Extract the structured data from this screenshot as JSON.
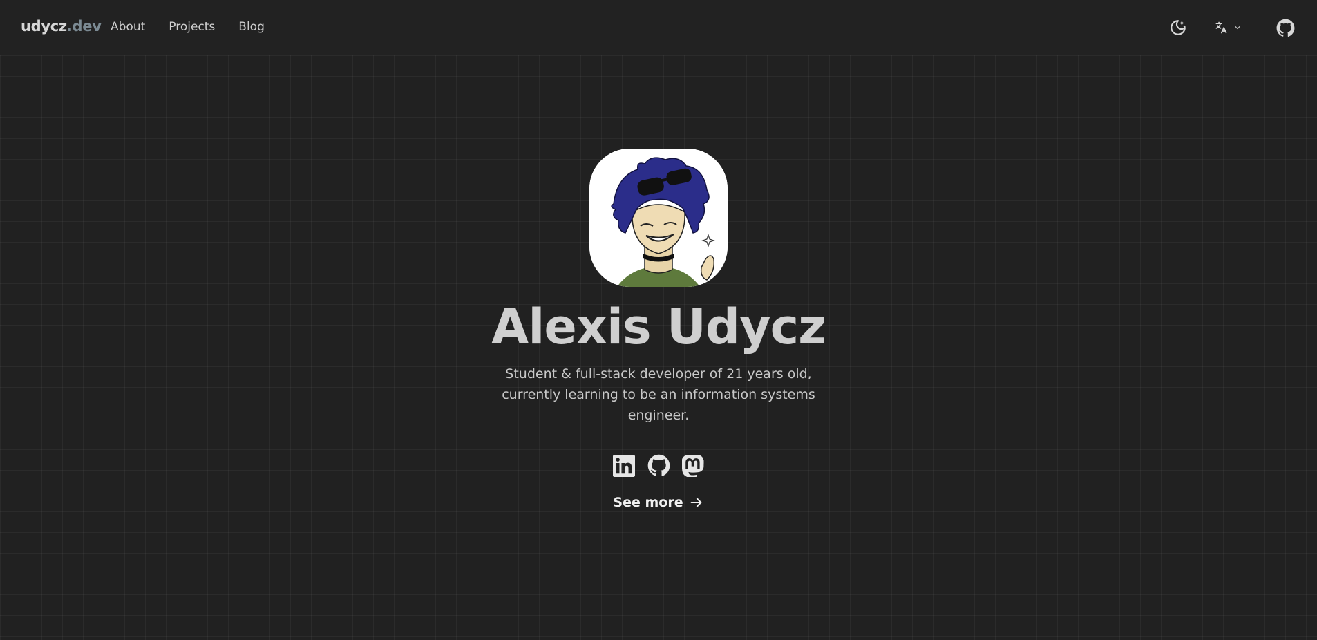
{
  "header": {
    "logo_main": "udycz",
    "logo_suffix": ".dev",
    "nav": [
      {
        "label": "About"
      },
      {
        "label": "Projects"
      },
      {
        "label": "Blog"
      }
    ],
    "icons": [
      "theme-toggle-icon",
      "translate-icon",
      "chevron-down-icon",
      "github-icon"
    ]
  },
  "hero": {
    "name": "Alexis Udycz",
    "tagline": "Student & full-stack developer of 21 years old, currently learning to be an information systems engineer.",
    "socials": [
      "linkedin-icon",
      "github-icon",
      "mastodon-icon"
    ],
    "see_more": "See more"
  },
  "colors": {
    "background": "#212121",
    "text": "#cfcfcf",
    "logo_suffix": "#7b8a93",
    "avatar_bg": "#ffffff",
    "hair": "#2b2d8a"
  }
}
